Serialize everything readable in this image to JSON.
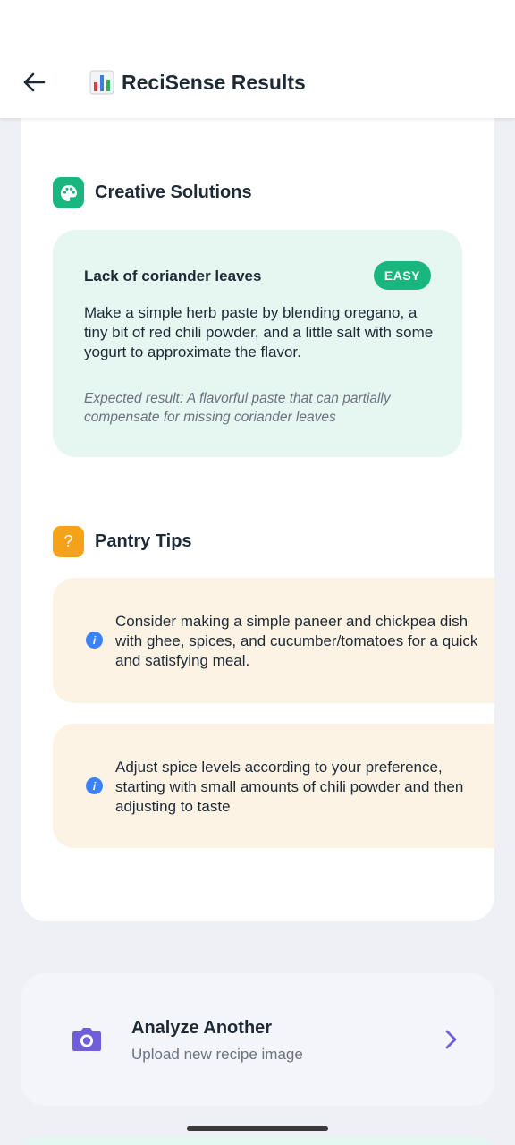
{
  "header": {
    "title": "ReciSense Results"
  },
  "creative": {
    "title": "Creative Solutions",
    "items": [
      {
        "title": "Lack of coriander leaves",
        "badge": "EASY",
        "description": "Make a simple herb paste by blending oregano, a tiny bit of red chili powder, and a little salt with some yogurt to approximate the flavor.",
        "result": "Expected result: A flavorful paste that can partially compensate for missing coriander leaves"
      }
    ]
  },
  "pantry": {
    "title": "Pantry Tips",
    "icon_glyph": "?",
    "tips": [
      "Consider making a simple paneer and chickpea dish with ghee, spices, and cucumber/tomatoes for a quick and satisfying meal.",
      "Adjust spice levels according to your preference, starting with small amounts of chili powder and then adjusting to taste"
    ]
  },
  "analyze": {
    "title": "Analyze Another",
    "subtitle": "Upload new recipe image"
  },
  "colors": {
    "accent_green": "#19b77f",
    "accent_orange": "#f4a21a",
    "accent_purple": "#6e5fd8",
    "info_blue": "#3b82f6",
    "solution_bg": "#e6f6f0",
    "tip_bg": "#fdf3e5"
  },
  "icons": {
    "back": "arrow-left-icon",
    "title": "bar-chart-icon",
    "creative": "palette-icon",
    "pantry": "question-icon",
    "tip": "info-icon",
    "analyze": "camera-icon",
    "chevron": "chevron-right-icon"
  }
}
